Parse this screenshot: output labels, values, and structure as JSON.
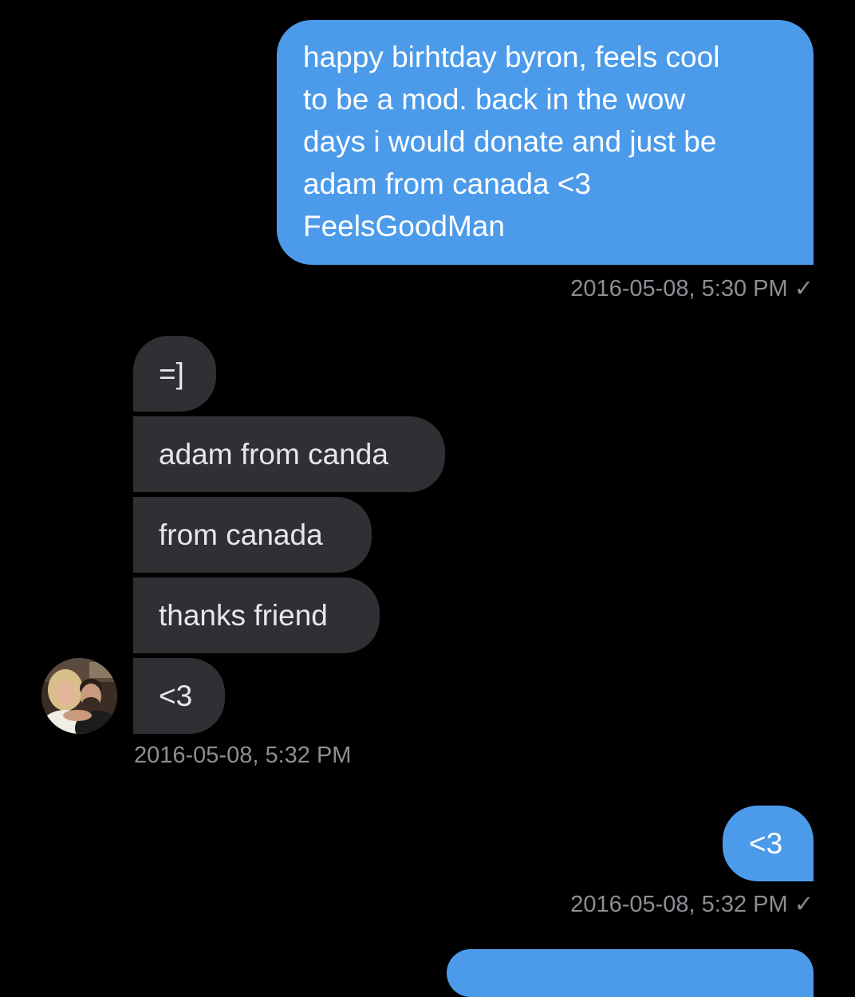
{
  "messages": {
    "outgoing_1": {
      "lines": [
        "happy birhtday byron, feels cool",
        "to be a mod. back in the wow",
        "days i would donate and just be",
        "adam from canada <3",
        "FeelsGoodMan"
      ],
      "timestamp": "2016-05-08, 5:30 PM",
      "status_icon": "✓"
    },
    "incoming": [
      "=]",
      "adam from canda",
      "from canada",
      "thanks friend",
      "<3"
    ],
    "incoming_timestamp": "2016-05-08, 5:32 PM",
    "outgoing_2": {
      "text": "<3",
      "timestamp": "2016-05-08, 5:32 PM",
      "status_icon": "✓"
    }
  },
  "colors": {
    "outgoing_bubble": "#4c9bea",
    "incoming_bubble": "#2f3033",
    "timestamp": "#8b8f94",
    "background": "#000000"
  }
}
